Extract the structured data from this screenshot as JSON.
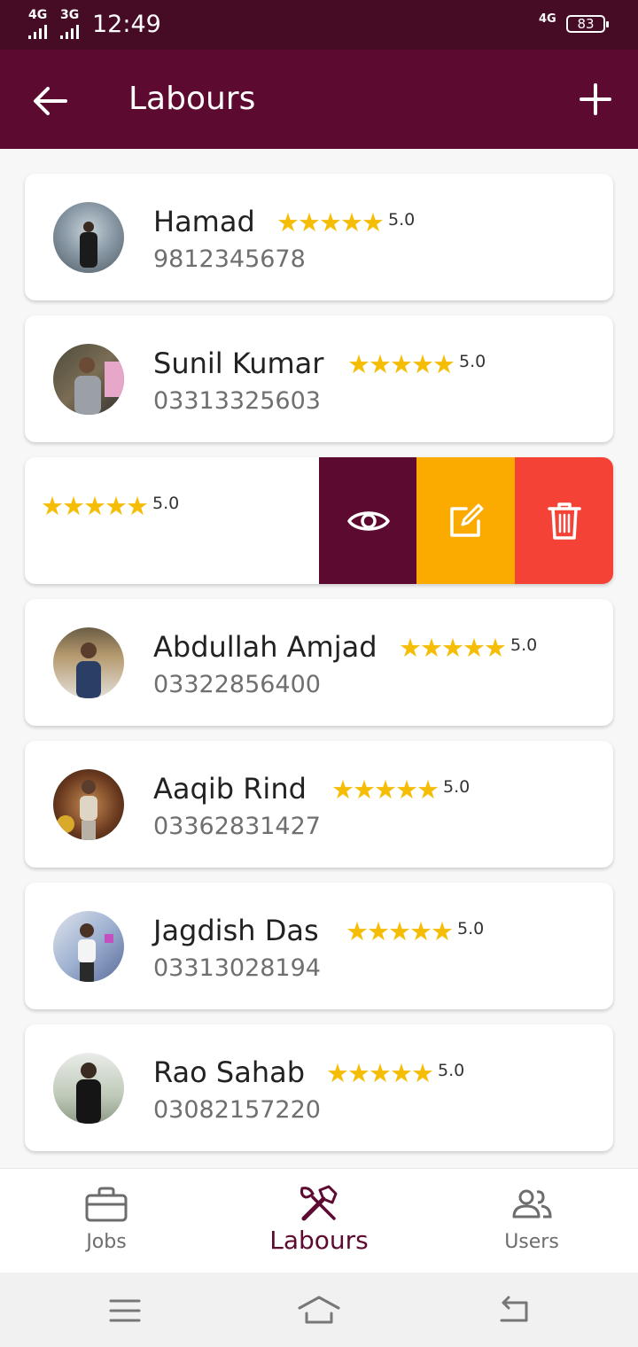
{
  "status_bar": {
    "network_1": "4G",
    "network_2": "3G",
    "time": "12:49",
    "right_network": "4G",
    "battery": "83"
  },
  "app_bar": {
    "title": "Labours",
    "back_icon": "arrow-left-icon",
    "add_icon": "plus-icon"
  },
  "labours": [
    {
      "name": "Hamad",
      "phone": "9812345678",
      "stars": "★★★★★",
      "rating": "5.0"
    },
    {
      "name": "Sunil Kumar",
      "phone": "03313325603",
      "stars": "★★★★★",
      "rating": "5.0"
    },
    {
      "name": "",
      "phone": "",
      "stars": "★★★★★",
      "rating": "5.0",
      "swiped": true
    },
    {
      "name": "Abdullah Amjad",
      "phone": "03322856400",
      "stars": "★★★★★",
      "rating": "5.0"
    },
    {
      "name": "Aaqib Rind",
      "phone": "03362831427",
      "stars": "★★★★★",
      "rating": "5.0"
    },
    {
      "name": "Jagdish Das",
      "phone": "03313028194",
      "stars": "★★★★★",
      "rating": "5.0"
    },
    {
      "name": "Rao Sahab",
      "phone": "03082157220",
      "stars": "★★★★★",
      "rating": "5.0"
    }
  ],
  "swipe_actions": {
    "view_icon": "eye-icon",
    "edit_icon": "edit-icon",
    "delete_icon": "trash-icon"
  },
  "bottom_nav": {
    "items": [
      {
        "label": "Jobs",
        "icon": "briefcase-icon",
        "active": false
      },
      {
        "label": "Labours",
        "icon": "tools-icon",
        "active": true
      },
      {
        "label": "Users",
        "icon": "users-icon",
        "active": false
      }
    ]
  },
  "colors": {
    "primary": "#5d0a31",
    "status": "#460b25",
    "star": "#f5bd06",
    "edit": "#fbab00",
    "delete": "#f44336"
  }
}
